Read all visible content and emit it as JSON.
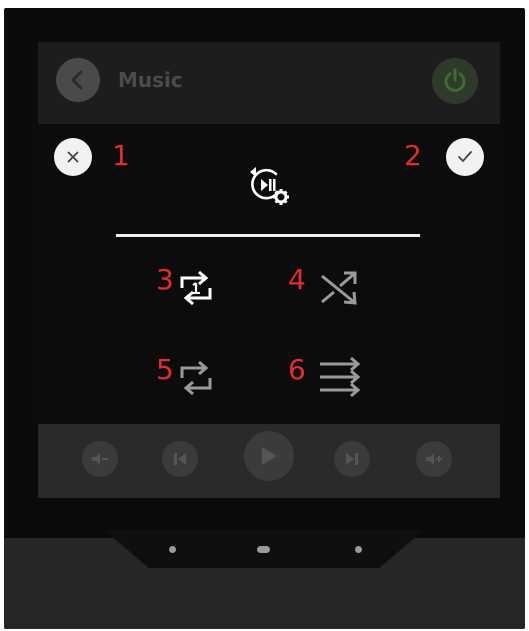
{
  "app": {
    "title": "Music"
  },
  "dialog": {
    "icon": "repeat-shuffle-settings-icon",
    "close": {
      "icon": "close-icon",
      "marker": "1"
    },
    "confirm": {
      "icon": "check-icon",
      "marker": "2"
    },
    "options": [
      {
        "name": "repeat-one",
        "icon": "repeat-one-icon",
        "marker": "3",
        "state": "selected"
      },
      {
        "name": "shuffle",
        "icon": "shuffle-icon",
        "marker": "4",
        "state": "unselected"
      },
      {
        "name": "repeat-all",
        "icon": "repeat-all-icon",
        "marker": "5",
        "state": "unselected"
      },
      {
        "name": "play-in-order",
        "icon": "play-in-order-icon",
        "marker": "6",
        "state": "unselected"
      }
    ]
  },
  "player_controls": [
    "volume-down-icon",
    "previous-icon",
    "play-icon",
    "next-icon",
    "volume-up-icon"
  ],
  "colors": {
    "marker": "#e52a2a",
    "selected": "#ffffff",
    "unselected": "#9a9a9a",
    "power": "#3f6b2e"
  }
}
